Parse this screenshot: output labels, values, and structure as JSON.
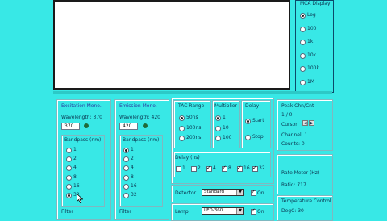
{
  "mca": {
    "title": "MCA Display",
    "options": [
      "Log",
      "100",
      "1k",
      "10k",
      "100k",
      "1M"
    ],
    "selected": "Log"
  },
  "excitation": {
    "title": "Excitation Mono.",
    "wavelength_label": "Wavelength: 370",
    "wavelength_value": "370",
    "bandpass_title": "Bandpass (nm)",
    "bandpass_options": [
      "1",
      "2",
      "4",
      "8",
      "16",
      "32"
    ],
    "bandpass_selected": "32",
    "filter_label": "Filter"
  },
  "emission": {
    "title": "Emission Mono.",
    "wavelength_label": "Wavelength: 420",
    "wavelength_value": "420",
    "bandpass_title": "Bandpass (nm)",
    "bandpass_options": [
      "1",
      "2",
      "4",
      "8",
      "16",
      "32"
    ],
    "bandpass_selected": "1",
    "filter_label": "Filter"
  },
  "tac": {
    "title": "TAC Range",
    "options": [
      "50ns",
      "100ns",
      "200ns"
    ],
    "selected": "50ns"
  },
  "multiplier": {
    "title": "Multiplier",
    "options": [
      "1",
      "10",
      "100"
    ],
    "selected": "1"
  },
  "delay_mode": {
    "title": "Delay",
    "options": [
      "Start",
      "Stop"
    ],
    "selected": "Start"
  },
  "delay_ns": {
    "title": "Delay (ns)",
    "options": [
      "1",
      "2",
      "4",
      "8",
      "16",
      "32"
    ],
    "checked": [
      "4",
      "8",
      "16",
      "32"
    ]
  },
  "detector": {
    "label": "Detector",
    "value": "Standard",
    "toggle_label": "On"
  },
  "lamp": {
    "label": "Lamp",
    "value": "LED-360",
    "toggle_label": "On"
  },
  "peak": {
    "title": "Peak Chn/Cnt",
    "value": "1 / 0",
    "cursor_label": "Cursor",
    "channel": "Channel:  1",
    "counts": "Counts:   0"
  },
  "rate_meter": {
    "title": "Rate Meter (Hz)",
    "value": "Ratio: 717"
  },
  "temperature": {
    "title": "Temperature Control",
    "value": "DegC: 30"
  }
}
